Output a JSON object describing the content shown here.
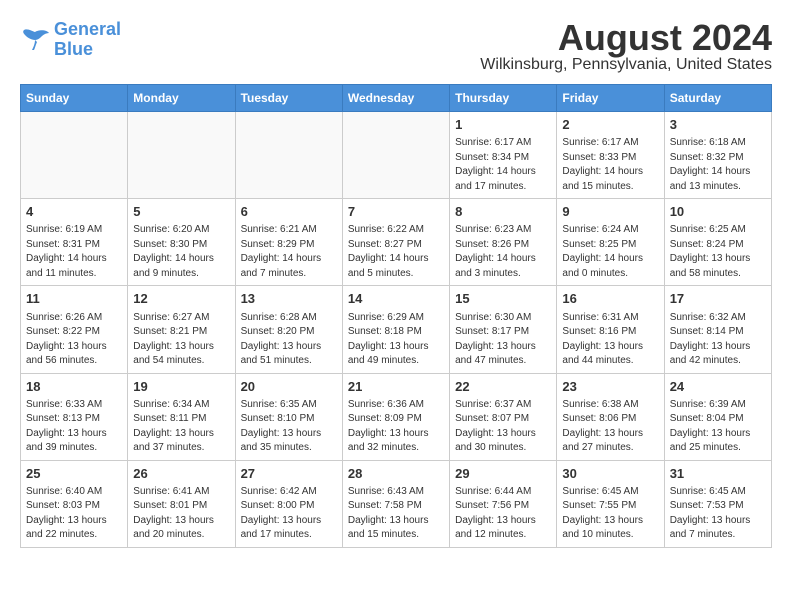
{
  "header": {
    "logo_line1": "General",
    "logo_line2": "Blue",
    "title": "August 2024",
    "subtitle": "Wilkinsburg, Pennsylvania, United States"
  },
  "calendar": {
    "days_of_week": [
      "Sunday",
      "Monday",
      "Tuesday",
      "Wednesday",
      "Thursday",
      "Friday",
      "Saturday"
    ],
    "weeks": [
      [
        {
          "day": "",
          "info": "",
          "empty": true
        },
        {
          "day": "",
          "info": "",
          "empty": true
        },
        {
          "day": "",
          "info": "",
          "empty": true
        },
        {
          "day": "",
          "info": "",
          "empty": true
        },
        {
          "day": "1",
          "info": "Sunrise: 6:17 AM\nSunset: 8:34 PM\nDaylight: 14 hours\nand 17 minutes."
        },
        {
          "day": "2",
          "info": "Sunrise: 6:17 AM\nSunset: 8:33 PM\nDaylight: 14 hours\nand 15 minutes."
        },
        {
          "day": "3",
          "info": "Sunrise: 6:18 AM\nSunset: 8:32 PM\nDaylight: 14 hours\nand 13 minutes."
        }
      ],
      [
        {
          "day": "4",
          "info": "Sunrise: 6:19 AM\nSunset: 8:31 PM\nDaylight: 14 hours\nand 11 minutes."
        },
        {
          "day": "5",
          "info": "Sunrise: 6:20 AM\nSunset: 8:30 PM\nDaylight: 14 hours\nand 9 minutes."
        },
        {
          "day": "6",
          "info": "Sunrise: 6:21 AM\nSunset: 8:29 PM\nDaylight: 14 hours\nand 7 minutes."
        },
        {
          "day": "7",
          "info": "Sunrise: 6:22 AM\nSunset: 8:27 PM\nDaylight: 14 hours\nand 5 minutes."
        },
        {
          "day": "8",
          "info": "Sunrise: 6:23 AM\nSunset: 8:26 PM\nDaylight: 14 hours\nand 3 minutes."
        },
        {
          "day": "9",
          "info": "Sunrise: 6:24 AM\nSunset: 8:25 PM\nDaylight: 14 hours\nand 0 minutes."
        },
        {
          "day": "10",
          "info": "Sunrise: 6:25 AM\nSunset: 8:24 PM\nDaylight: 13 hours\nand 58 minutes."
        }
      ],
      [
        {
          "day": "11",
          "info": "Sunrise: 6:26 AM\nSunset: 8:22 PM\nDaylight: 13 hours\nand 56 minutes."
        },
        {
          "day": "12",
          "info": "Sunrise: 6:27 AM\nSunset: 8:21 PM\nDaylight: 13 hours\nand 54 minutes."
        },
        {
          "day": "13",
          "info": "Sunrise: 6:28 AM\nSunset: 8:20 PM\nDaylight: 13 hours\nand 51 minutes."
        },
        {
          "day": "14",
          "info": "Sunrise: 6:29 AM\nSunset: 8:18 PM\nDaylight: 13 hours\nand 49 minutes."
        },
        {
          "day": "15",
          "info": "Sunrise: 6:30 AM\nSunset: 8:17 PM\nDaylight: 13 hours\nand 47 minutes."
        },
        {
          "day": "16",
          "info": "Sunrise: 6:31 AM\nSunset: 8:16 PM\nDaylight: 13 hours\nand 44 minutes."
        },
        {
          "day": "17",
          "info": "Sunrise: 6:32 AM\nSunset: 8:14 PM\nDaylight: 13 hours\nand 42 minutes."
        }
      ],
      [
        {
          "day": "18",
          "info": "Sunrise: 6:33 AM\nSunset: 8:13 PM\nDaylight: 13 hours\nand 39 minutes."
        },
        {
          "day": "19",
          "info": "Sunrise: 6:34 AM\nSunset: 8:11 PM\nDaylight: 13 hours\nand 37 minutes."
        },
        {
          "day": "20",
          "info": "Sunrise: 6:35 AM\nSunset: 8:10 PM\nDaylight: 13 hours\nand 35 minutes."
        },
        {
          "day": "21",
          "info": "Sunrise: 6:36 AM\nSunset: 8:09 PM\nDaylight: 13 hours\nand 32 minutes."
        },
        {
          "day": "22",
          "info": "Sunrise: 6:37 AM\nSunset: 8:07 PM\nDaylight: 13 hours\nand 30 minutes."
        },
        {
          "day": "23",
          "info": "Sunrise: 6:38 AM\nSunset: 8:06 PM\nDaylight: 13 hours\nand 27 minutes."
        },
        {
          "day": "24",
          "info": "Sunrise: 6:39 AM\nSunset: 8:04 PM\nDaylight: 13 hours\nand 25 minutes."
        }
      ],
      [
        {
          "day": "25",
          "info": "Sunrise: 6:40 AM\nSunset: 8:03 PM\nDaylight: 13 hours\nand 22 minutes."
        },
        {
          "day": "26",
          "info": "Sunrise: 6:41 AM\nSunset: 8:01 PM\nDaylight: 13 hours\nand 20 minutes."
        },
        {
          "day": "27",
          "info": "Sunrise: 6:42 AM\nSunset: 8:00 PM\nDaylight: 13 hours\nand 17 minutes."
        },
        {
          "day": "28",
          "info": "Sunrise: 6:43 AM\nSunset: 7:58 PM\nDaylight: 13 hours\nand 15 minutes."
        },
        {
          "day": "29",
          "info": "Sunrise: 6:44 AM\nSunset: 7:56 PM\nDaylight: 13 hours\nand 12 minutes."
        },
        {
          "day": "30",
          "info": "Sunrise: 6:45 AM\nSunset: 7:55 PM\nDaylight: 13 hours\nand 10 minutes."
        },
        {
          "day": "31",
          "info": "Sunrise: 6:45 AM\nSunset: 7:53 PM\nDaylight: 13 hours\nand 7 minutes."
        }
      ]
    ]
  }
}
